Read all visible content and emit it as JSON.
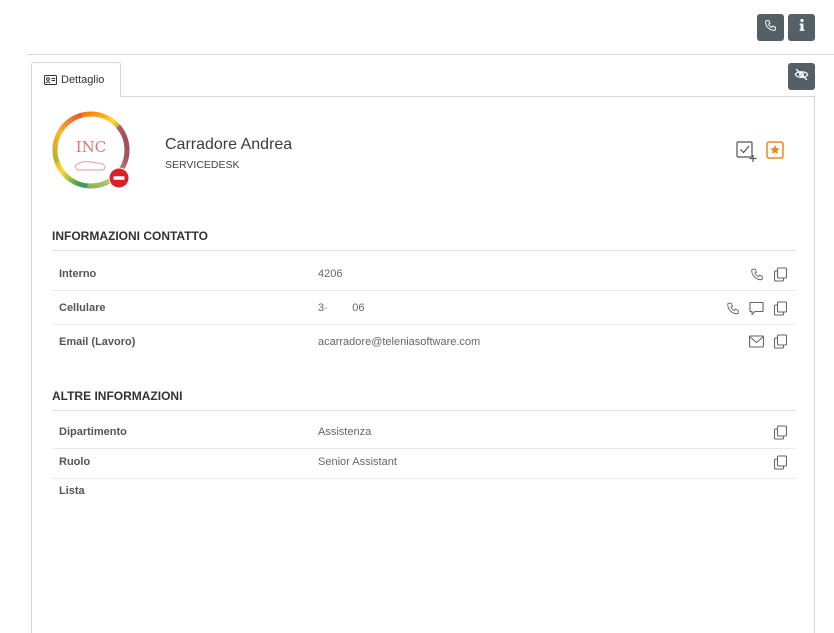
{
  "toolbar": {
    "call_icon": "phone-icon",
    "info_icon": "info-icon",
    "visibility_icon": "eye-off-icon"
  },
  "tabs": [
    {
      "label": "Dettaglio",
      "icon": "id-card-icon"
    }
  ],
  "contact": {
    "name": "Carradore Andrea",
    "group": "SERVICEDESK",
    "avatar_text": "INC",
    "status": "do-not-disturb",
    "status_color": "#d9212b"
  },
  "sections": {
    "contact_info": {
      "title": "INFORMAZIONI CONTATTO",
      "rows": [
        {
          "label": "Interno",
          "value": "4206"
        },
        {
          "label": "Cellulare",
          "value": "3·        06"
        },
        {
          "label": "Email (Lavoro)",
          "value": "acarradore@teleniasoftware.com"
        }
      ]
    },
    "other_info": {
      "title": "ALTRE INFORMAZIONI",
      "rows": [
        {
          "label": "Dipartimento",
          "value": "Assistenza"
        },
        {
          "label": "Ruolo",
          "value": "Senior Assistant"
        },
        {
          "label": "Lista",
          "value": ""
        }
      ]
    }
  },
  "colors": {
    "dark_button": "#555f66",
    "favorite_accent": "#e8891a",
    "icon_gray": "#666666"
  }
}
